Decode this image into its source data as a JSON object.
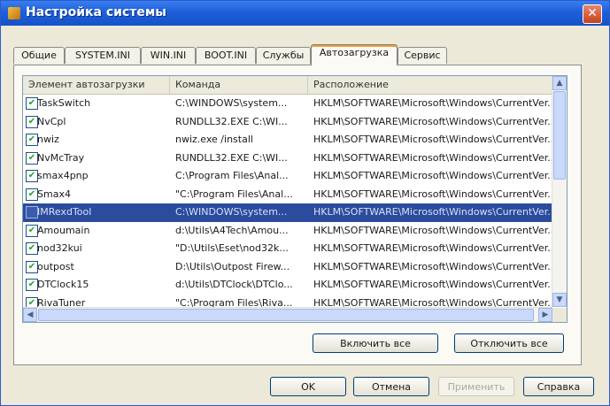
{
  "window": {
    "title": "Настройка системы",
    "close_label": "✕"
  },
  "tabs": [
    {
      "label": "Общие"
    },
    {
      "label": "SYSTEM.INI"
    },
    {
      "label": "WIN.INI"
    },
    {
      "label": "BOOT.INI"
    },
    {
      "label": "Службы"
    },
    {
      "label": "Автозагрузка",
      "active": true
    },
    {
      "label": "Сервис"
    }
  ],
  "list": {
    "columns": [
      "Элемент автозагрузки",
      "Команда",
      "Расположение"
    ],
    "rows": [
      {
        "name": "TaskSwitch",
        "command": "C:\\WINDOWS\\system...",
        "location": "HKLM\\SOFTWARE\\Microsoft\\Windows\\CurrentVer...",
        "checked": true
      },
      {
        "name": "NvCpl",
        "command": "RUNDLL32.EXE C:\\WI...",
        "location": "HKLM\\SOFTWARE\\Microsoft\\Windows\\CurrentVer...",
        "checked": true
      },
      {
        "name": "nwiz",
        "command": "nwiz.exe /install",
        "location": "HKLM\\SOFTWARE\\Microsoft\\Windows\\CurrentVer...",
        "checked": true
      },
      {
        "name": "NvMcTray",
        "command": "RUNDLL32.EXE C:\\WI...",
        "location": "HKLM\\SOFTWARE\\Microsoft\\Windows\\CurrentVer...",
        "checked": true
      },
      {
        "name": "smax4pnp",
        "command": "C:\\Program Files\\Anal...",
        "location": "HKLM\\SOFTWARE\\Microsoft\\Windows\\CurrentVer...",
        "checked": true
      },
      {
        "name": "Smax4",
        "command": "\"C:\\Program Files\\Anal...",
        "location": "HKLM\\SOFTWARE\\Microsoft\\Windows\\CurrentVer...",
        "checked": true
      },
      {
        "name": "IMRexdTool",
        "command": "C:\\WINDOWS\\system...",
        "location": "HKLM\\SOFTWARE\\Microsoft\\Windows\\CurrentVer...",
        "checked": false,
        "selected": true
      },
      {
        "name": "Amoumain",
        "command": "d:\\Utils\\A4Tech\\Amou...",
        "location": "HKLM\\SOFTWARE\\Microsoft\\Windows\\CurrentVer...",
        "checked": true
      },
      {
        "name": "nod32kui",
        "command": "\"D:\\Utils\\Eset\\nod32k...",
        "location": "HKLM\\SOFTWARE\\Microsoft\\Windows\\CurrentVer...",
        "checked": true
      },
      {
        "name": "outpost",
        "command": "D:\\Utils\\Outpost Firew...",
        "location": "HKLM\\SOFTWARE\\Microsoft\\Windows\\CurrentVer...",
        "checked": true
      },
      {
        "name": "DTClock15",
        "command": "d:\\Utils\\DTClock\\DTClo...",
        "location": "HKLM\\SOFTWARE\\Microsoft\\Windows\\CurrentVer...",
        "checked": true
      },
      {
        "name": "RivaTuner",
        "command": "\"C:\\Program Files\\Riva...",
        "location": "HKLM\\SOFTWARE\\Microsoft\\Windows\\CurrentVer...",
        "checked": true
      }
    ]
  },
  "actions": {
    "enable_all": "Включить все",
    "disable_all": "Отключить все"
  },
  "footer": {
    "ok": "OK",
    "cancel": "Отмена",
    "apply": "Применить",
    "help": "Справка"
  }
}
